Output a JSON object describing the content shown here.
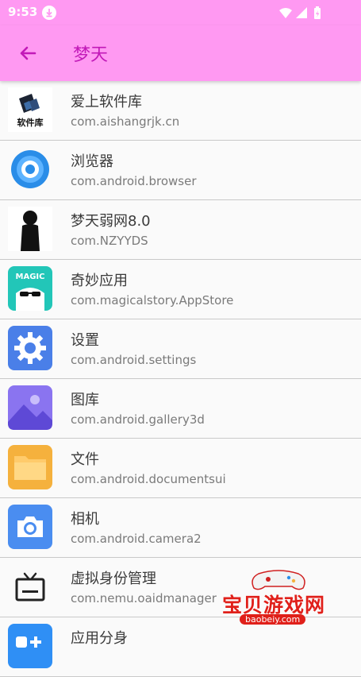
{
  "status_bar": {
    "time": "9:53",
    "download_icon": "download-icon",
    "wifi_icon": "wifi-icon",
    "signal_icon": "signal-icon",
    "battery_icon": "battery-icon"
  },
  "app_bar": {
    "back_icon": "arrow-back-icon",
    "title": "梦天",
    "color": "#ff99f2",
    "title_color": "#c219b8"
  },
  "apps": [
    {
      "name": "爱上软件库",
      "package": "com.aishangrjk.cn",
      "icon": "aishang-logo-icon",
      "icon_text": "软件库"
    },
    {
      "name": "浏览器",
      "package": "com.android.browser",
      "icon": "browser-icon"
    },
    {
      "name": "梦天弱网8.0",
      "package": "com.NZYYDS",
      "icon": "silhouette-icon"
    },
    {
      "name": "奇妙应用",
      "package": "com.magicalstory.AppStore",
      "icon": "magic-app-icon",
      "icon_text": "MAGIC"
    },
    {
      "name": "设置",
      "package": "com.android.settings",
      "icon": "settings-gear-icon"
    },
    {
      "name": "图库",
      "package": "com.android.gallery3d",
      "icon": "gallery-icon"
    },
    {
      "name": "文件",
      "package": "com.android.documentsui",
      "icon": "folder-icon"
    },
    {
      "name": "相机",
      "package": "com.android.camera2",
      "icon": "camera-icon"
    },
    {
      "name": "虚拟身份管理",
      "package": "com.nemu.oaidmanager",
      "icon": "tv-icon"
    },
    {
      "name": "应用分身",
      "package": "",
      "icon": "app-clone-icon"
    }
  ],
  "watermark": {
    "text": "宝贝游戏网",
    "sub": "baobeiy.com"
  }
}
